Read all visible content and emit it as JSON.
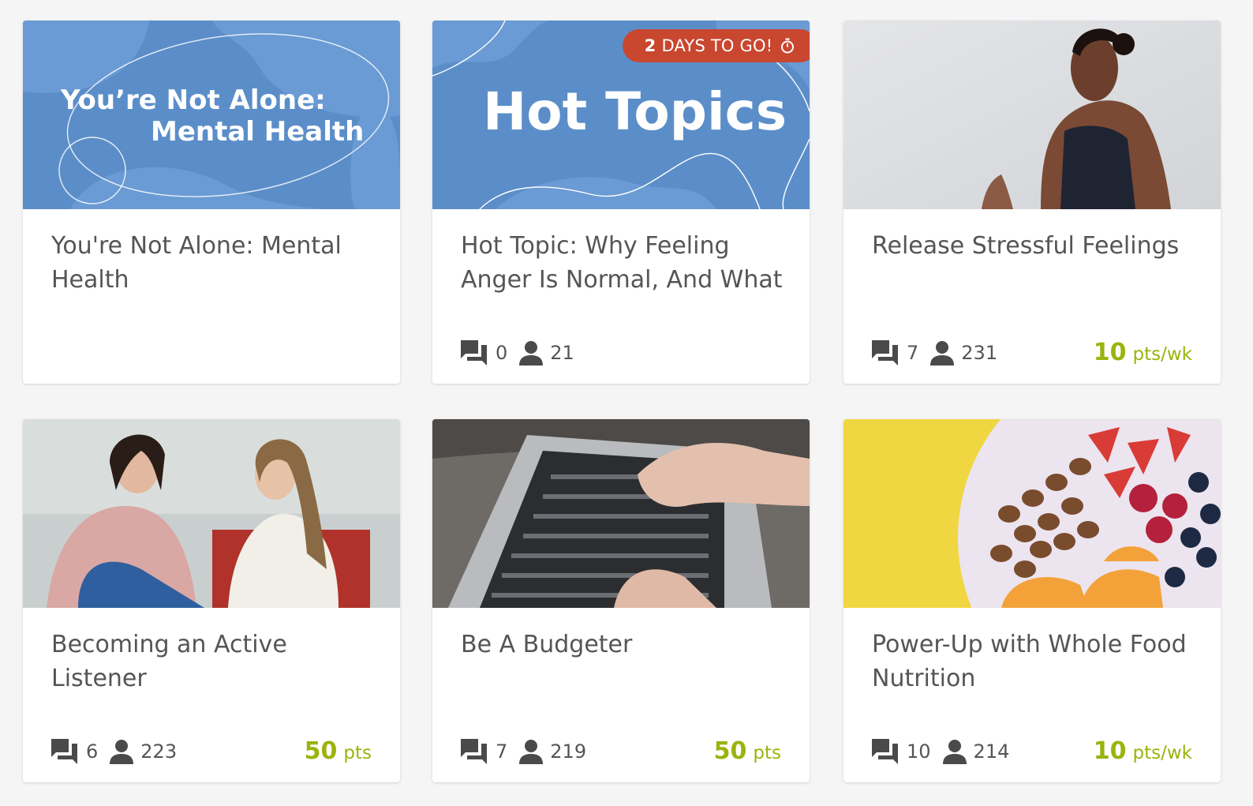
{
  "cards": [
    {
      "title": "You're Not Alone: Mental Health",
      "image": {
        "type": "banner",
        "line1": "You’re Not Alone:",
        "line2": "Mental Health"
      }
    },
    {
      "title": "Hot Topic: Why Feeling Anger Is Normal, And What",
      "image": {
        "type": "banner",
        "heading": "Hot Topics"
      },
      "badge": {
        "number": "2",
        "text": "DAYS TO GO!",
        "icon": "stopwatch-icon"
      },
      "comments": "0",
      "participants": "21"
    },
    {
      "title": "Release Stressful Feelings",
      "image": {
        "type": "photo",
        "subject": "woman meditating"
      },
      "comments": "7",
      "participants": "231",
      "points": {
        "value": "10",
        "unit": "pts/wk"
      }
    },
    {
      "title": "Becoming an Active Listener",
      "image": {
        "type": "photo",
        "subject": "two women talking"
      },
      "comments": "6",
      "participants": "223",
      "points": {
        "value": "50",
        "unit": "pts"
      }
    },
    {
      "title": "Be A Budgeter",
      "image": {
        "type": "photo",
        "subject": "hands typing on laptop"
      },
      "comments": "7",
      "participants": "219",
      "points": {
        "value": "50",
        "unit": "pts"
      }
    },
    {
      "title": "Power-Up with Whole Food Nutrition",
      "image": {
        "type": "photo",
        "subject": "bowl of fruit and nuts"
      },
      "comments": "10",
      "participants": "214",
      "points": {
        "value": "10",
        "unit": "pts/wk"
      }
    }
  ],
  "colors": {
    "banner": "#5b8ec9",
    "badge": "#c9462f",
    "points": "#9bb30c",
    "text": "#555555"
  },
  "icons": {
    "comments": "comments-icon",
    "participants": "person-icon"
  }
}
